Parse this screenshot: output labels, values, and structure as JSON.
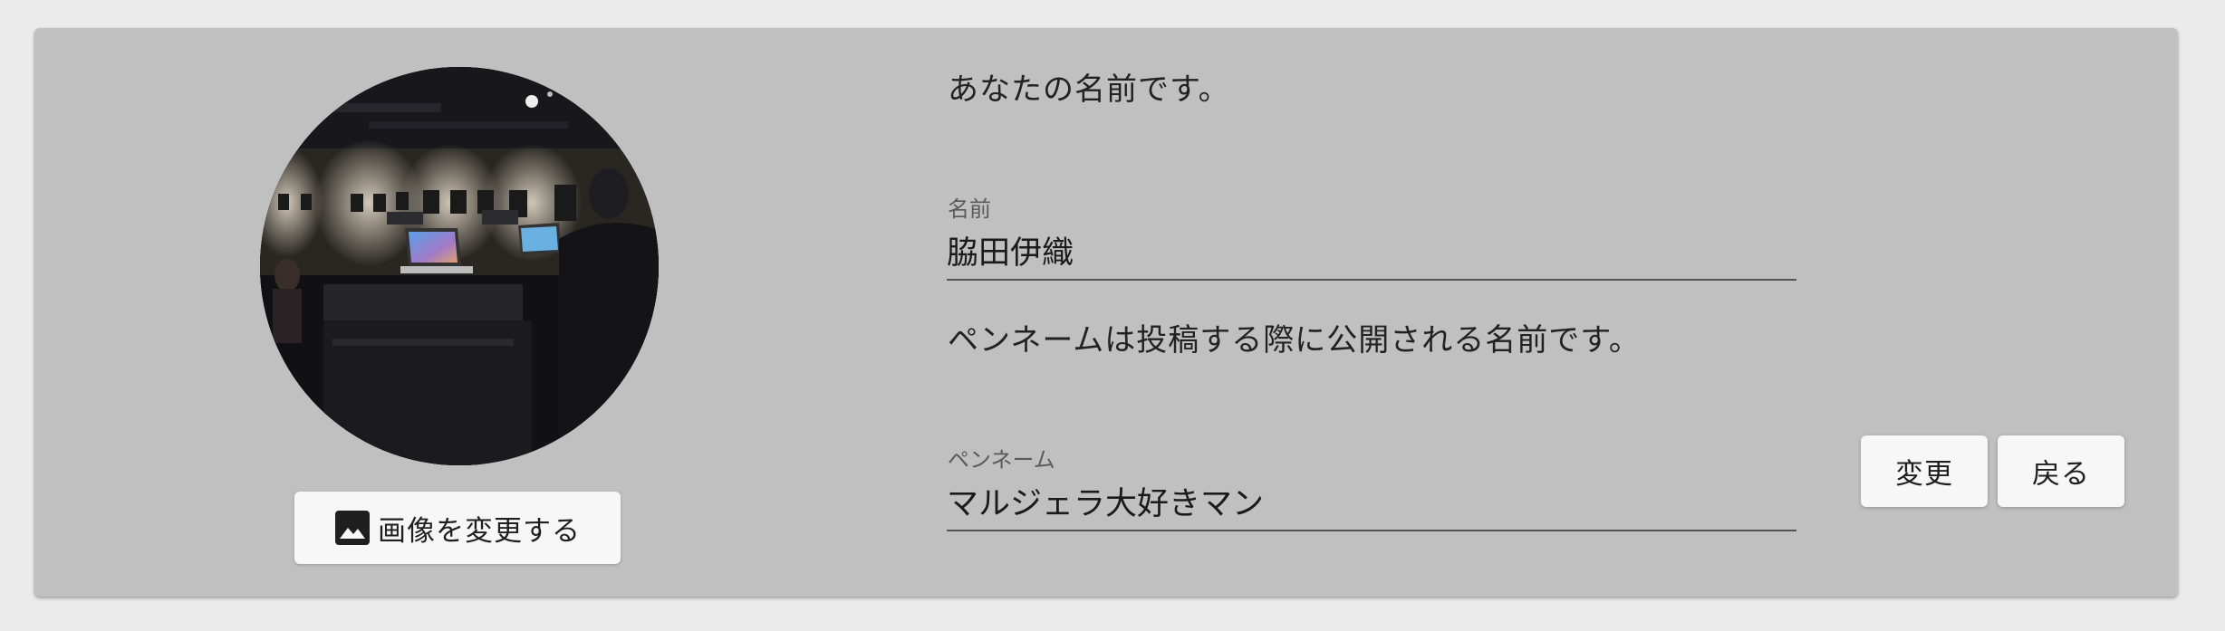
{
  "avatar": {
    "change_image_label": "画像を変更する",
    "change_image_icon": "image-icon"
  },
  "name_section": {
    "description": "あなたの名前です。",
    "label": "名前",
    "value": "脇田伊織"
  },
  "pen_name_section": {
    "description": "ペンネームは投稿する際に公開される名前です。",
    "label": "ペンネーム",
    "value": "マルジェラ大好きマン"
  },
  "actions": {
    "change_label": "変更",
    "back_label": "戻る"
  },
  "colors": {
    "page_background": "#ebebeb",
    "card_background": "#c0c0c0",
    "button_background": "#f7f7f7"
  }
}
